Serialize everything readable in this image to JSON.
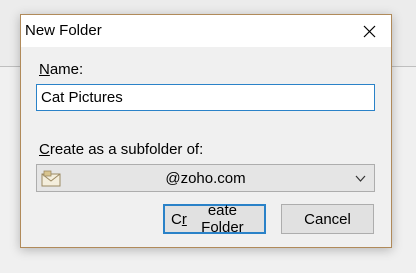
{
  "dialog": {
    "title": "New Folder",
    "close_icon": "close-icon",
    "name_label": "Name:",
    "name_label_access_key": "N",
    "name_label_rest": "ame:",
    "name_value": "Cat Pictures",
    "subfolder_label_access_key": "C",
    "subfolder_label_rest": "reate as a subfolder of:",
    "account_icon": "envelope-icon",
    "account_value": "@zoho.com",
    "create_button_pre": "C",
    "create_button_access_key": "r",
    "create_button_post": "eate Folder",
    "cancel_button": "Cancel"
  },
  "colors": {
    "focus_border": "#2a82c8",
    "dialog_border": "#b08a5a",
    "dialog_background": "#f0f0f0"
  }
}
